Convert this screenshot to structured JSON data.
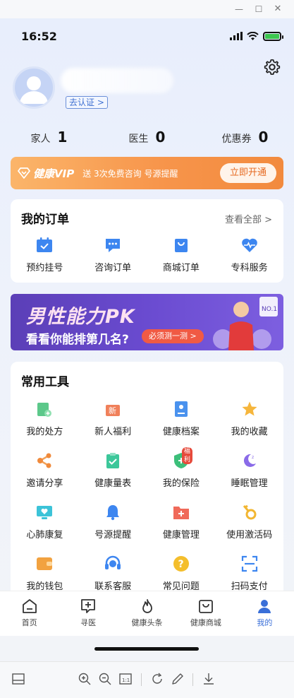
{
  "status_bar": {
    "time": "16:52"
  },
  "profile": {
    "auth_tag": "去认证 >"
  },
  "stats": [
    {
      "label": "家人",
      "value": "1"
    },
    {
      "label": "医生",
      "value": "0"
    },
    {
      "label": "优惠券",
      "value": "0"
    }
  ],
  "vip": {
    "logo_text": "健康VIP",
    "description": "送 3次免费咨询 号源提醒",
    "button": "立即开通"
  },
  "orders": {
    "title": "我的订单",
    "more": "查看全部 >",
    "items": [
      {
        "label": "预约挂号",
        "icon": "calendar-check-icon"
      },
      {
        "label": "咨询订单",
        "icon": "chat-icon"
      },
      {
        "label": "商城订单",
        "icon": "shopping-bag-icon"
      },
      {
        "label": "专科服务",
        "icon": "heart-pulse-icon"
      }
    ]
  },
  "promo": {
    "title": "男性能力PK",
    "subtitle": "看看你能排第几名?",
    "button": "必须测一测 >",
    "badge": "NO.1"
  },
  "tools": {
    "title": "常用工具",
    "items": [
      {
        "label": "我的处方",
        "icon": "prescription-icon"
      },
      {
        "label": "新人福利",
        "icon": "gift-icon",
        "badge": "新"
      },
      {
        "label": "健康档案",
        "icon": "health-record-icon"
      },
      {
        "label": "我的收藏",
        "icon": "star-icon"
      },
      {
        "label": "邀请分享",
        "icon": "share-icon"
      },
      {
        "label": "健康量表",
        "icon": "scale-icon"
      },
      {
        "label": "我的保险",
        "icon": "insurance-shield-icon",
        "badge": "福利"
      },
      {
        "label": "睡眠管理",
        "icon": "moon-icon"
      },
      {
        "label": "心肺康复",
        "icon": "monitor-heart-icon"
      },
      {
        "label": "号源提醒",
        "icon": "bell-icon"
      },
      {
        "label": "健康管理",
        "icon": "medical-folder-icon"
      },
      {
        "label": "使用激活码",
        "icon": "key-icon"
      },
      {
        "label": "我的钱包",
        "icon": "wallet-icon"
      },
      {
        "label": "联系客服",
        "icon": "headset-icon"
      },
      {
        "label": "常见问题",
        "icon": "question-icon"
      },
      {
        "label": "扫码支付",
        "icon": "scan-icon"
      }
    ]
  },
  "tabbar": [
    {
      "label": "首页",
      "icon": "home-icon",
      "active": false
    },
    {
      "label": "寻医",
      "icon": "find-doctor-icon",
      "active": false
    },
    {
      "label": "健康头条",
      "icon": "flame-icon",
      "active": false
    },
    {
      "label": "健康商城",
      "icon": "mall-icon",
      "active": false
    },
    {
      "label": "我的",
      "icon": "user-icon",
      "active": true
    }
  ],
  "colors": {
    "accent": "#3a6fd8",
    "vip_orange": "#f7954b",
    "promo_purple": "#6a4bd0"
  }
}
